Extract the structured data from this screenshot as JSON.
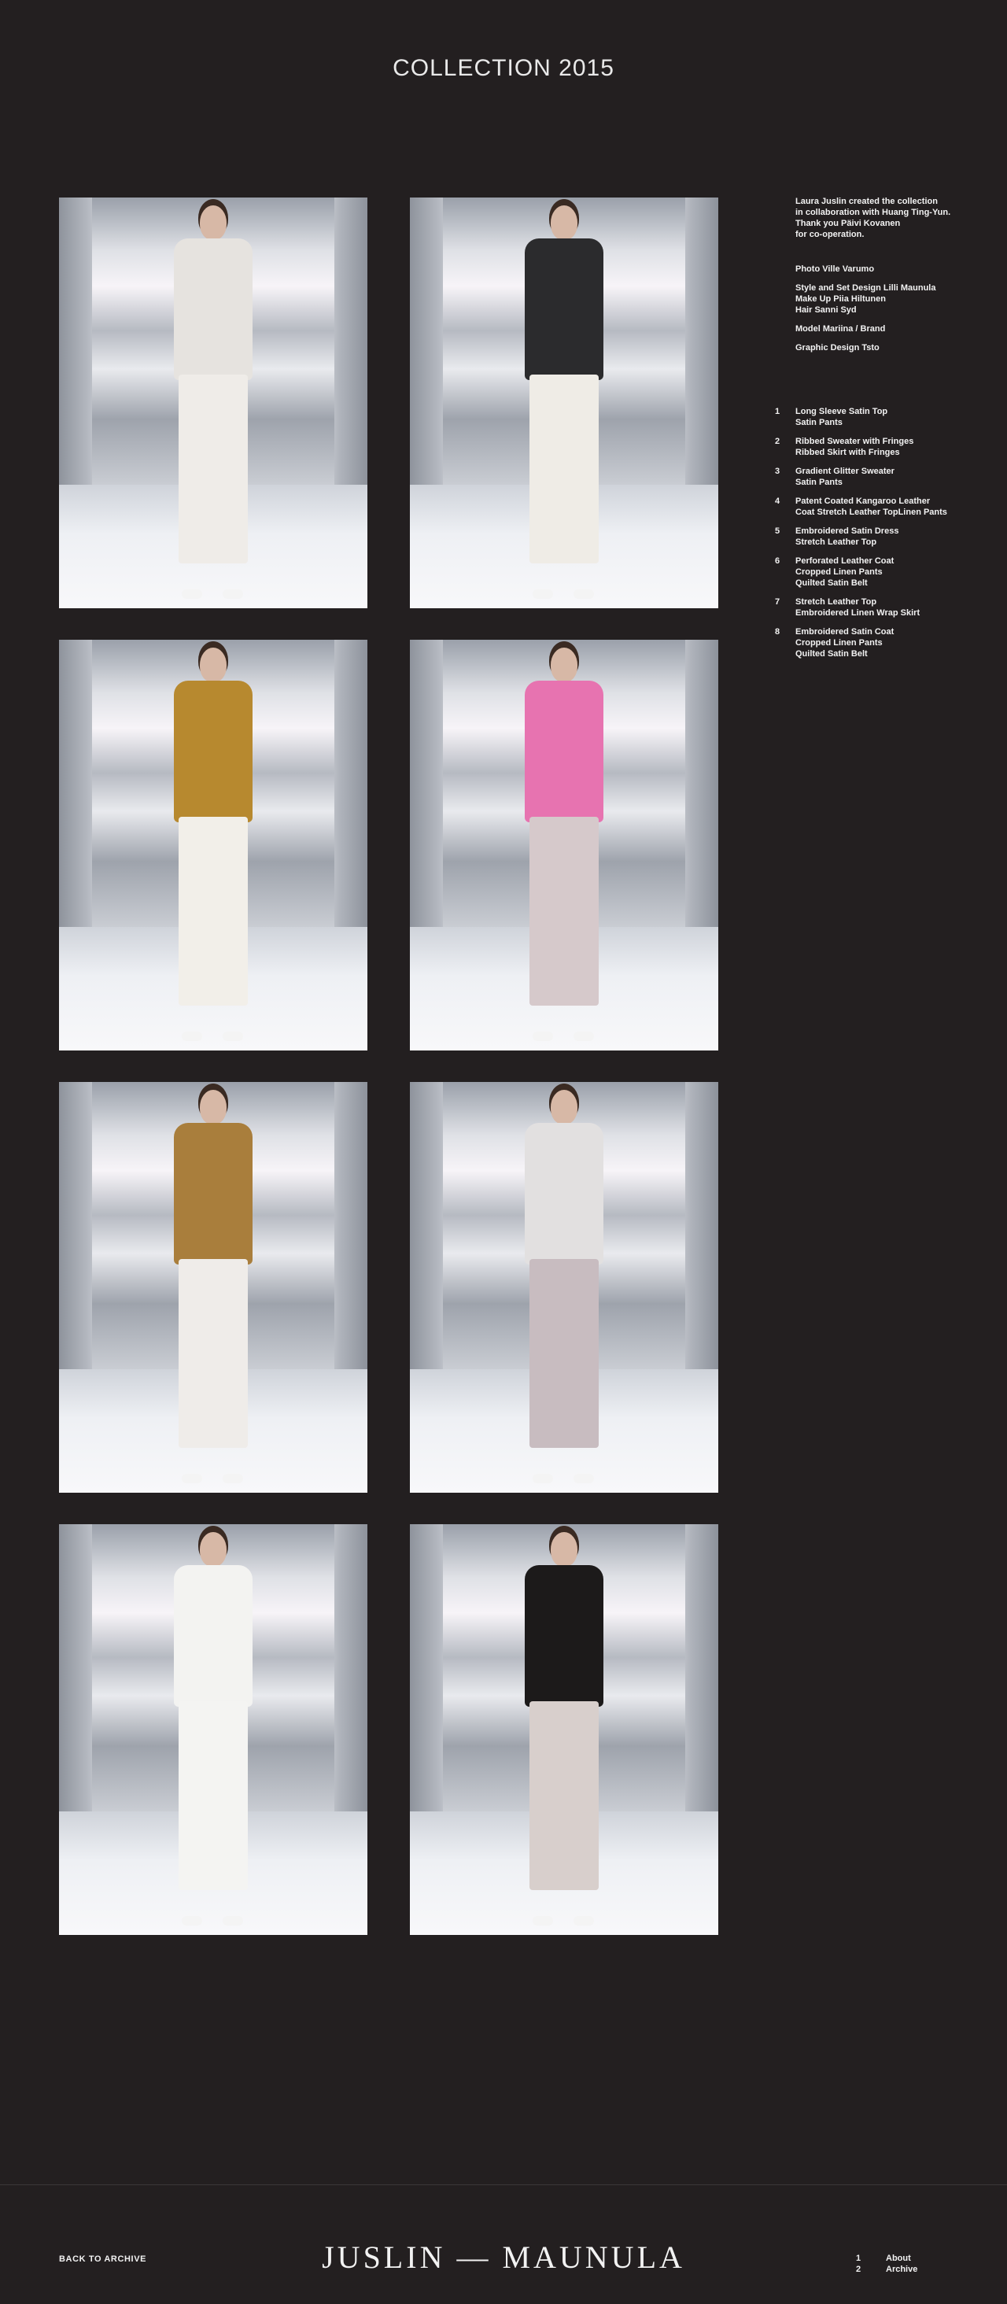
{
  "page": {
    "title": "COLLECTION 2015"
  },
  "looks": [
    {
      "top": "#e6e3df",
      "bottom": "#efece8",
      "legs": "#f1f1f1"
    },
    {
      "top": "#2b2b2d",
      "bottom": "#efece6",
      "legs": "#efece6"
    },
    {
      "top": "#b7892f",
      "bottom": "#f2efe9",
      "legs": "#e0c6b6"
    },
    {
      "top": "#e773b0",
      "bottom": "#d6c9cb",
      "legs": "#d6c9cb"
    },
    {
      "top": "#a97e3c",
      "bottom": "#efece9",
      "legs": "#e4c5b5"
    },
    {
      "top": "#e2e0e0",
      "bottom": "#c8bcc0",
      "legs": "#c8bcc0"
    },
    {
      "top": "#f3f3f1",
      "bottom": "#f4f4f2",
      "legs": "#f4f4f2"
    },
    {
      "top": "#1c1a1a",
      "bottom": "#d8cfcc",
      "legs": "#d8cfcc"
    }
  ],
  "sidebar": {
    "intro": [
      "Laura Juslin created the collection",
      "in collaboration with Huang Ting-Yun.",
      "Thank you Päivi Kovanen",
      "for co-operation."
    ],
    "credits": [
      [
        "Photo  Ville Varumo"
      ],
      [
        "Style and Set Design  Lilli Maunula",
        "Make Up  Piia Hiltunen",
        "Hair  Sanni Syd"
      ],
      [
        "Model  Mariina / Brand"
      ],
      [
        "Graphic Design  Tsto"
      ]
    ],
    "look_list": [
      {
        "num": "1",
        "lines": [
          "Long Sleeve Satin Top",
          "Satin Pants"
        ]
      },
      {
        "num": "2",
        "lines": [
          "Ribbed Sweater with Fringes",
          "Ribbed Skirt with Fringes"
        ]
      },
      {
        "num": "3",
        "lines": [
          "Gradient Glitter Sweater",
          "Satin Pants"
        ]
      },
      {
        "num": "4",
        "lines": [
          "Patent Coated Kangaroo Leather",
          "Coat Stretch Leather TopLinen Pants"
        ]
      },
      {
        "num": "5",
        "lines": [
          "Embroidered Satin Dress",
          "Stretch Leather Top"
        ]
      },
      {
        "num": "6",
        "lines": [
          "Perforated Leather Coat",
          "Cropped Linen Pants",
          "Quilted Satin Belt"
        ]
      },
      {
        "num": "7",
        "lines": [
          "Stretch Leather Top",
          "Embroidered Linen Wrap Skirt"
        ]
      },
      {
        "num": "8",
        "lines": [
          "Embroidered Satin Coat",
          "Cropped Linen Pants",
          "Quilted Satin Belt"
        ]
      }
    ]
  },
  "footer": {
    "back_label": "BACK TO ARCHIVE",
    "logo": "JUSLIN — MAUNULA",
    "nav": [
      {
        "num": "1",
        "label": "About"
      },
      {
        "num": "2",
        "label": "Archive"
      }
    ]
  }
}
